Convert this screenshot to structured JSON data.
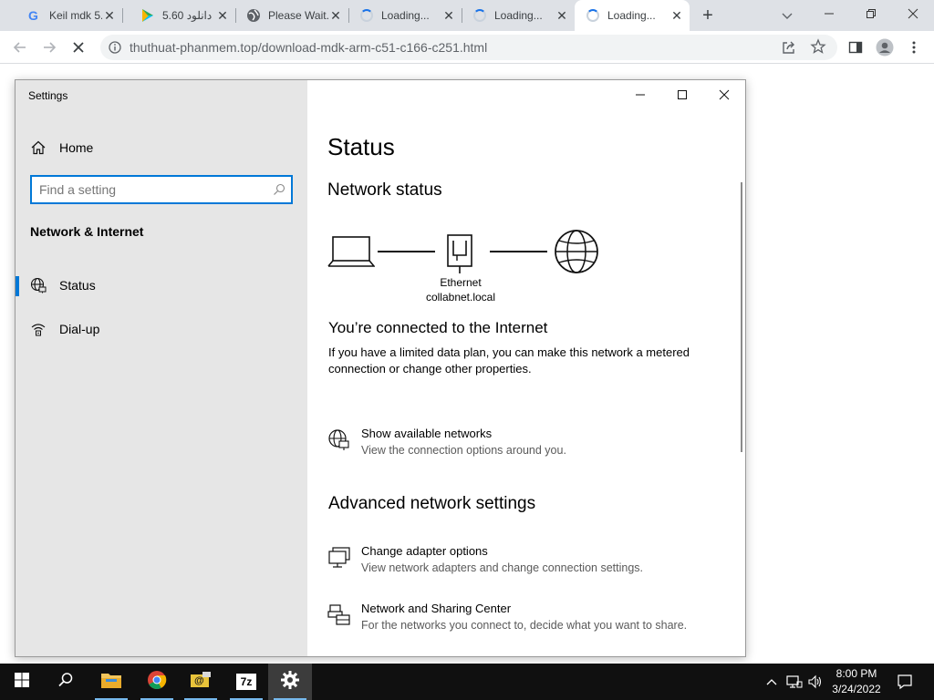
{
  "browser": {
    "tabs": [
      {
        "title": "Keil mdk 5...",
        "icon": "google-icon"
      },
      {
        "title": "دانلود 5.60",
        "icon": "play-store-icon"
      },
      {
        "title": "Please Wait...",
        "icon": "globe-icon"
      },
      {
        "title": "Loading...",
        "icon": "spinner-icon"
      },
      {
        "title": "Loading...",
        "icon": "spinner-icon"
      },
      {
        "title": "Loading...",
        "icon": "spinner-icon",
        "active": true
      }
    ],
    "url": "thuthuat-phanmem.top/download-mdk-arm-c51-c166-c251.html"
  },
  "settings": {
    "window_title": "Settings",
    "home_label": "Home",
    "search_placeholder": "Find a setting",
    "section_heading": "Network & Internet",
    "nav": [
      {
        "label": "Status",
        "icon": "globe-icon",
        "selected": true
      },
      {
        "label": "Dial-up",
        "icon": "dialup-icon"
      }
    ],
    "page_title": "Status",
    "subheading": "Network status",
    "diagram": {
      "adapter_label": "Ethernet",
      "network_name": "collabnet.local"
    },
    "connection_title": "You’re connected to the Internet",
    "connection_desc": "If you have a limited data plan, you can make this network a metered connection or change other properties.",
    "show_networks": {
      "title": "Show available networks",
      "desc": "View the connection options around you.",
      "icon": "wifi-globe-icon"
    },
    "advanced_heading": "Advanced network settings",
    "advanced": [
      {
        "title": "Change adapter options",
        "desc": "View network adapters and change connection settings.",
        "icon": "adapter-icon"
      },
      {
        "title": "Network and Sharing Center",
        "desc": "For the networks you connect to, decide what you want to share.",
        "icon": "sharing-center-icon"
      }
    ]
  },
  "taskbar": {
    "time": "8:00 PM",
    "date": "3/24/2022",
    "apps": [
      "start-icon",
      "search-icon",
      "file-explorer-icon",
      "chrome-icon",
      "mail-icon",
      "7zip-icon",
      "settings-gear-icon"
    ],
    "app_7zip_label": "7z"
  },
  "colors": {
    "accent": "#0078d7",
    "taskbar": "#101010",
    "sidebar": "#e6e6e6",
    "tabstrip": "#dee1e6"
  }
}
